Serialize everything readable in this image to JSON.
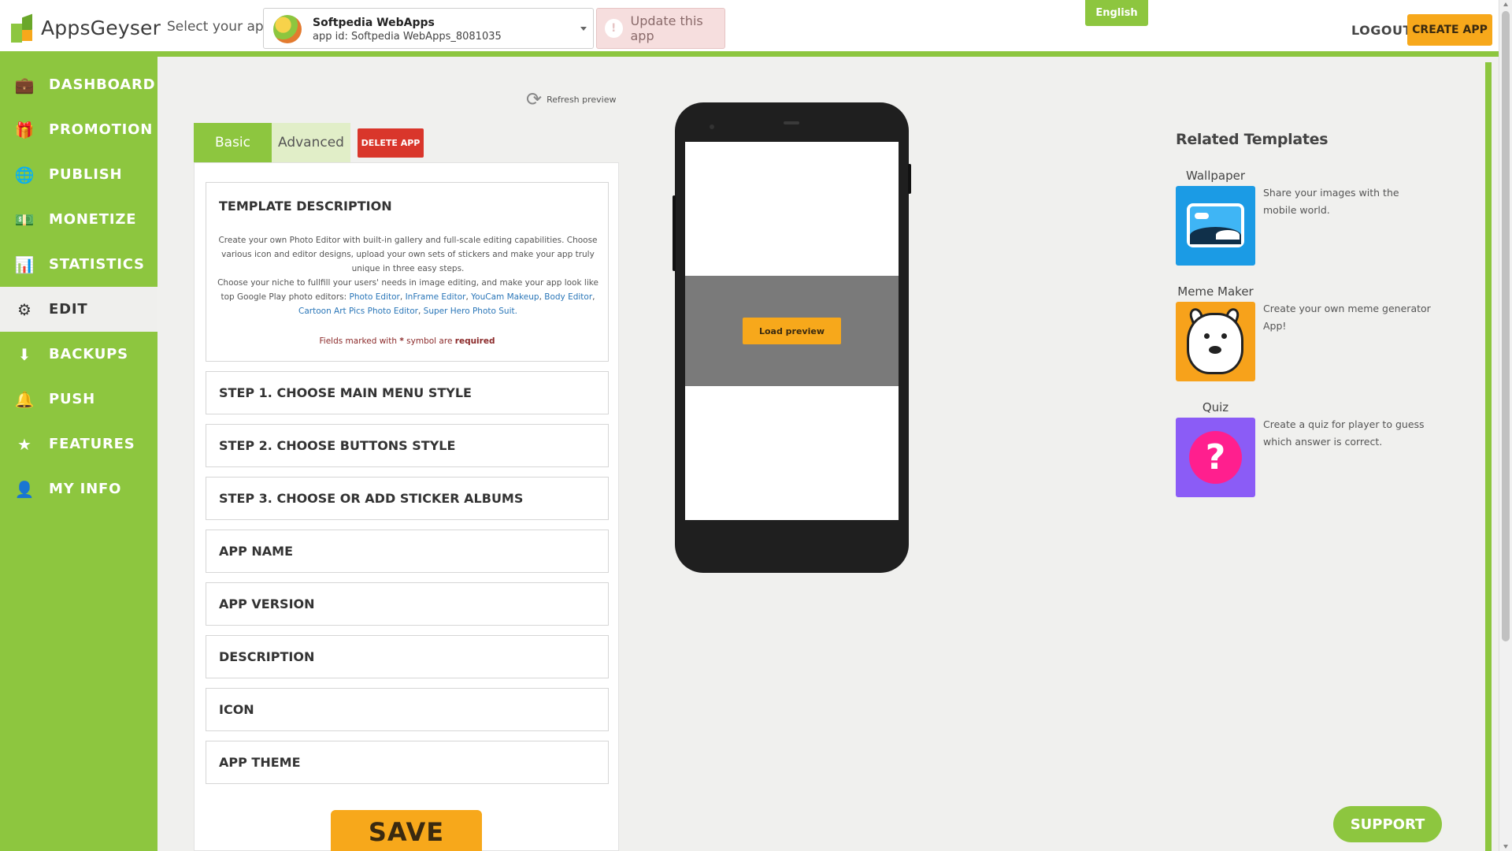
{
  "header": {
    "logo_text": "AppsGeyser",
    "select_label": "Select your app:",
    "app": {
      "name": "Softpedia WebApps",
      "id": "app id: Softpedia WebApps_8081035"
    },
    "update_label": "Update this app",
    "language": "English",
    "logout": "LOGOUT",
    "create_app": "CREATE APP"
  },
  "sidebar": {
    "items": [
      {
        "label": "DASHBOARD",
        "icon": "briefcase-icon",
        "glyph": "💼"
      },
      {
        "label": "PROMOTION",
        "icon": "gift-icon",
        "glyph": "🎁"
      },
      {
        "label": "PUBLISH",
        "icon": "globe-icon",
        "glyph": "🌐"
      },
      {
        "label": "MONETIZE",
        "icon": "money-icon",
        "glyph": "💵"
      },
      {
        "label": "STATISTICS",
        "icon": "bar-chart-icon",
        "glyph": "📊"
      },
      {
        "label": "EDIT",
        "icon": "gears-icon",
        "glyph": "⚙",
        "active": true
      },
      {
        "label": "BACKUPS",
        "icon": "download-icon",
        "glyph": "⬇"
      },
      {
        "label": "PUSH",
        "icon": "bell-icon",
        "glyph": "🔔"
      },
      {
        "label": "FEATURES",
        "icon": "star-icon",
        "glyph": "★"
      },
      {
        "label": "MY INFO",
        "icon": "user-icon",
        "glyph": "👤"
      }
    ]
  },
  "editor": {
    "refresh_label": "Refresh preview",
    "tabs": {
      "basic": "Basic",
      "advanced": "Advanced"
    },
    "delete_label": "DELETE APP",
    "template_description": {
      "title": "TEMPLATE DESCRIPTION",
      "line1": "Create your own Photo Editor with built-in gallery and full-scale editing capabilities. Choose various icon and editor designs, upload your own sets of stickers and make your app truly unique in three easy steps.",
      "line2": "Choose your niche to fullfill your users' needs in image editing, and make your app look like top Google Play photo editors:",
      "links": [
        "Photo Editor",
        "InFrame Editor",
        "YouCam Makeup",
        "Body Editor",
        "Cartoon Art Pics Photo Editor",
        "Super Hero Photo Suit."
      ],
      "required_prefix": "Fields marked with",
      "required_symbol": "*",
      "required_middle": "symbol are",
      "required_word": "required"
    },
    "steps": [
      "STEP 1. CHOOSE MAIN MENU STYLE",
      "STEP 2. CHOOSE BUTTONS STYLE",
      "STEP 3. CHOOSE OR ADD STICKER ALBUMS",
      "APP NAME",
      "APP VERSION",
      "DESCRIPTION",
      "ICON",
      "APP THEME"
    ],
    "save_label": "SAVE"
  },
  "preview": {
    "load_label": "Load preview"
  },
  "related": {
    "title": "Related Templates",
    "items": [
      {
        "name": "Wallpaper",
        "desc": "Share your images with the mobile world."
      },
      {
        "name": "Meme Maker",
        "desc": "Create your own meme generator App!"
      },
      {
        "name": "Quiz",
        "desc": "Create a quiz for player to guess which answer is correct."
      }
    ]
  },
  "support_label": "SUPPORT",
  "colors": {
    "brand_green": "#8dc63f",
    "accent_orange": "#f7a81b",
    "danger_red": "#d9362b"
  }
}
